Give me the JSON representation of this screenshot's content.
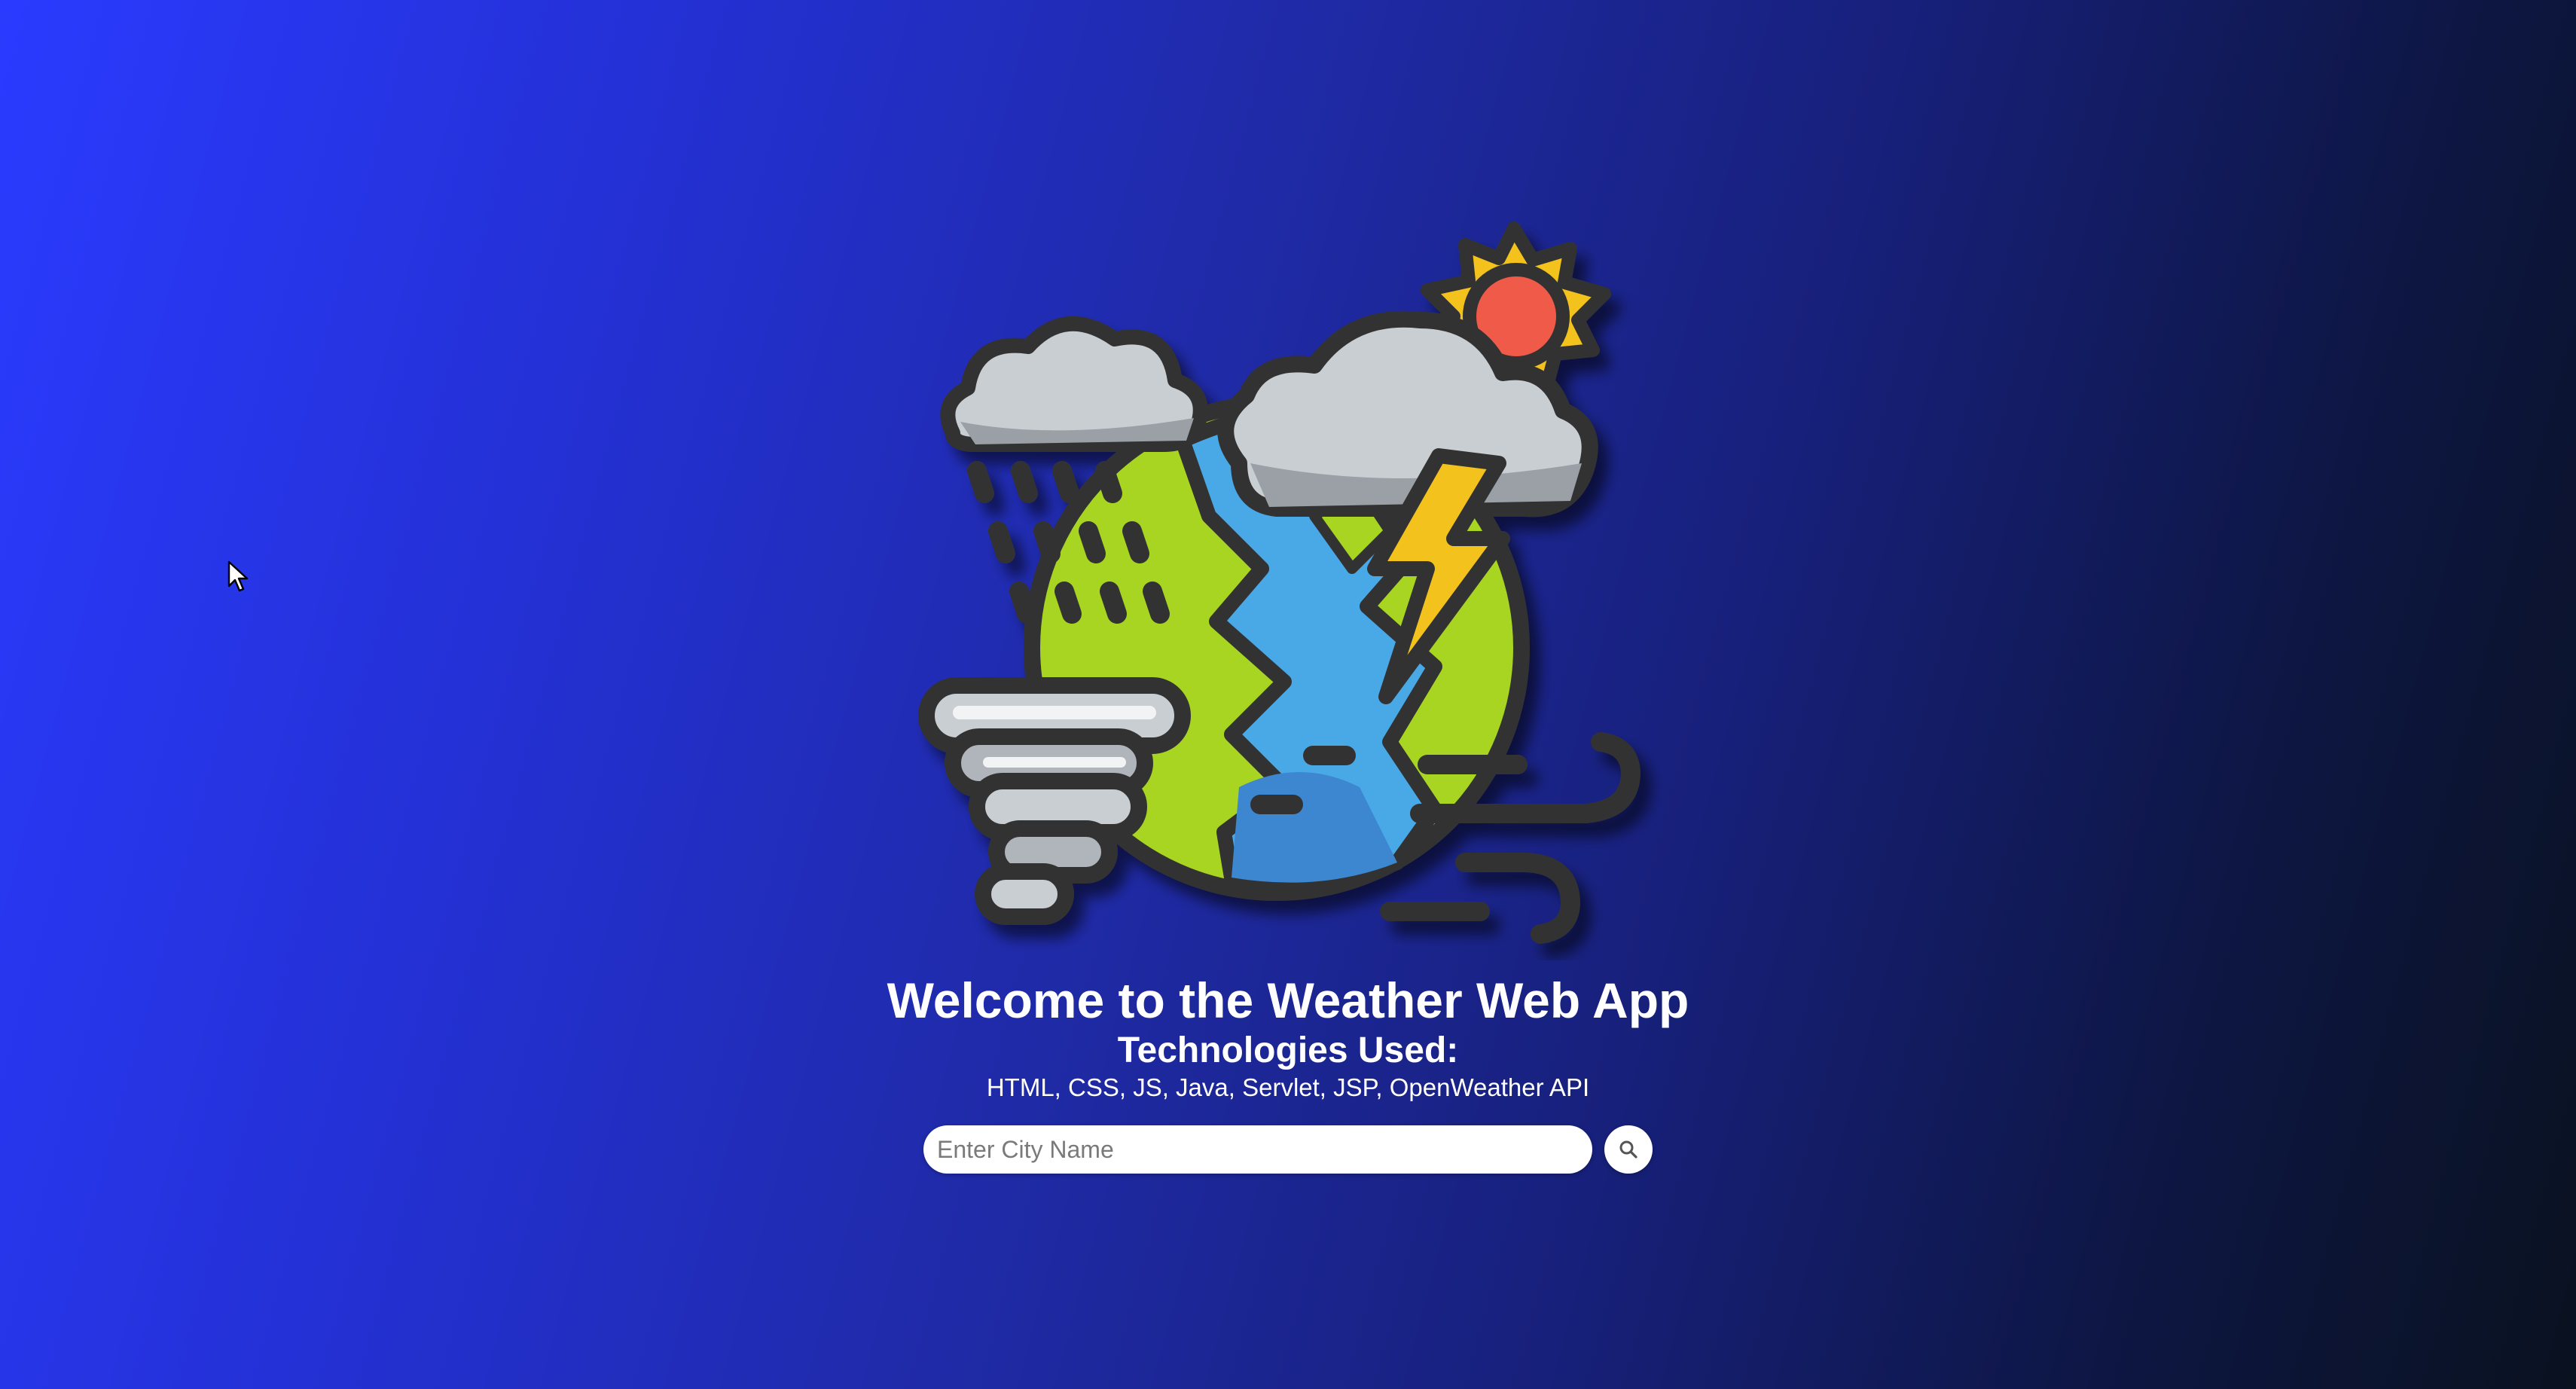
{
  "header": {
    "title": "Welcome to the Weather Web App",
    "tech_heading": "Technologies Used:",
    "tech_list": "HTML, CSS, JS, Java, Servlet, JSP, OpenWeather API"
  },
  "search": {
    "placeholder": "Enter City Name",
    "value": "",
    "button_icon": "search-icon"
  },
  "illustration": {
    "icon": "weather-globe-icon"
  },
  "colors": {
    "background_start": "#2a3bff",
    "background_end": "#0a1220",
    "text": "#ffffff",
    "input_background": "#ffffff"
  }
}
